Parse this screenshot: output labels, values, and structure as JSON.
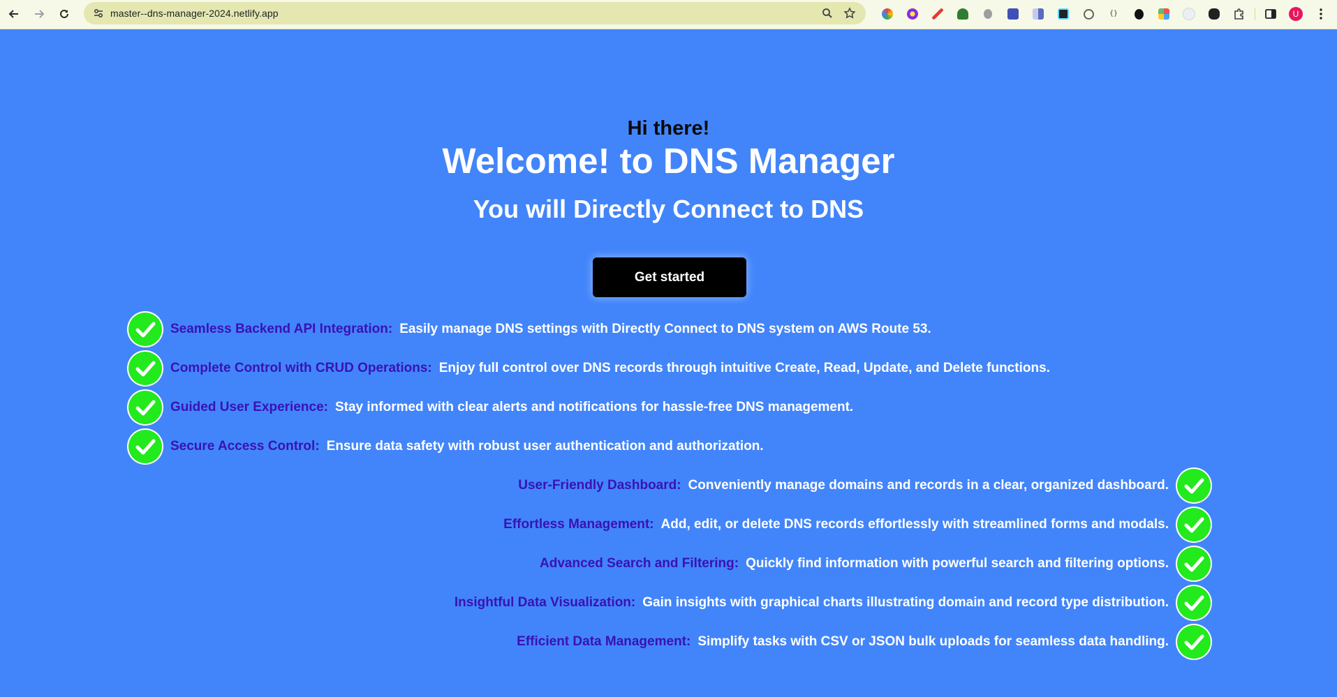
{
  "browser": {
    "url": "master--dns-manager-2024.netlify.app",
    "avatar_letter": "U",
    "extensions": [
      {
        "name": "color-picker-icon",
        "color": "#e94235"
      },
      {
        "name": "sun-flower-icon",
        "color": "#8a2be2"
      },
      {
        "name": "pen-icon",
        "color": "#e53935"
      },
      {
        "name": "tree-icon",
        "color": "#2e7d32"
      },
      {
        "name": "bug-icon",
        "color": "#9e9e9e"
      },
      {
        "name": "letter-b-icon",
        "color": "#3f51b5"
      },
      {
        "name": "panel-icon",
        "color": "#5c6bc0"
      },
      {
        "name": "react-devtools-icon",
        "color": "#20232a"
      },
      {
        "name": "zoom-icon",
        "color": "#616161"
      },
      {
        "name": "code-braces-icon",
        "color": "#424242"
      },
      {
        "name": "gnome-icon",
        "color": "#111111"
      },
      {
        "name": "palette-icon",
        "color": "#ef5350"
      },
      {
        "name": "moon-icon",
        "color": "#cfd8dc"
      },
      {
        "name": "mask-icon",
        "color": "#212121"
      }
    ]
  },
  "hero": {
    "greeting": "Hi there!",
    "title": "Welcome! to DNS Manager",
    "subtitle": "You will Directly Connect to DNS",
    "cta_label": "Get started"
  },
  "features": [
    {
      "title": "Seamless Backend API Integration:",
      "desc": "Easily manage DNS settings with Directly Connect to DNS system on AWS Route 53.",
      "align": "left"
    },
    {
      "title": "Complete Control with CRUD Operations:",
      "desc": "Enjoy full control over DNS records through intuitive Create, Read, Update, and Delete functions.",
      "align": "left"
    },
    {
      "title": "Guided User Experience:",
      "desc": "Stay informed with clear alerts and notifications for hassle-free DNS management.",
      "align": "left"
    },
    {
      "title": "Secure Access Control:",
      "desc": "Ensure data safety with robust user authentication and authorization.",
      "align": "left"
    },
    {
      "title": "User-Friendly Dashboard:",
      "desc": "Conveniently manage domains and records in a clear, organized dashboard.",
      "align": "right"
    },
    {
      "title": "Effortless Management:",
      "desc": "Add, edit, or delete DNS records effortlessly with streamlined forms and modals.",
      "align": "right"
    },
    {
      "title": "Advanced Search and Filtering:",
      "desc": "Quickly find information with powerful search and filtering options.",
      "align": "right"
    },
    {
      "title": "Insightful Data Visualization:",
      "desc": "Gain insights with graphical charts illustrating domain and record type distribution.",
      "align": "right"
    },
    {
      "title": "Efficient Data Management:",
      "desc": "Simplify tasks with CSV or JSON bulk uploads for seamless data handling.",
      "align": "right"
    }
  ],
  "colors": {
    "background": "#4285fa",
    "feature_title": "#3a12b4",
    "check_green": "#22ea1c"
  }
}
